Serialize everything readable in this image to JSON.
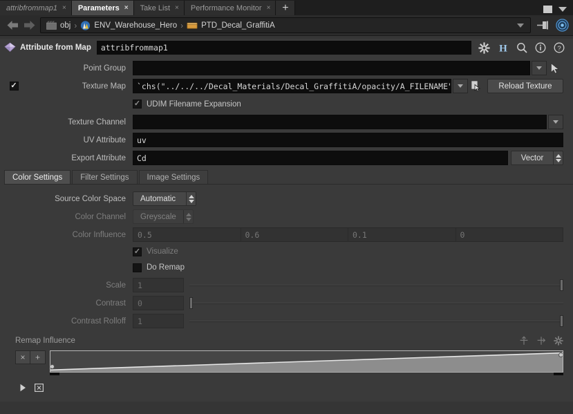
{
  "window": {
    "tabs": [
      {
        "label": "attribfrommap1",
        "active": false,
        "italic": true,
        "close": "×"
      },
      {
        "label": "Parameters",
        "active": true,
        "italic": false,
        "close": "×"
      },
      {
        "label": "Take List",
        "active": false,
        "italic": false,
        "close": "×"
      },
      {
        "label": "Performance Monitor",
        "active": false,
        "italic": false,
        "close": "×"
      }
    ],
    "add_tab_label": "+"
  },
  "breadcrumb": {
    "items": [
      {
        "label": "obj",
        "icon": "obj-network-icon"
      },
      {
        "label": "ENV_Warehouse_Hero",
        "icon": "geometry-object-icon"
      },
      {
        "label": "PTD_Decal_GraffitiA",
        "icon": "subnet-icon"
      }
    ],
    "separator": "›"
  },
  "node_header": {
    "type_label": "Attribute from Map",
    "node_name": "attribfrommap1",
    "icons": [
      "gear-icon",
      "houdini-h-icon",
      "search-icon",
      "info-icon",
      "help-icon"
    ]
  },
  "parameters": {
    "point_group": {
      "label": "Point Group",
      "value": "",
      "placeholder": ""
    },
    "texture_map": {
      "label": "Texture Map",
      "enabled": true,
      "value": "`chs(\"../../../Decal_Materials/Decal_GraffitiA/opacity/A_FILENAME\")`",
      "reload_button": "Reload Texture"
    },
    "udim": {
      "label": "UDIM Filename Expansion",
      "checked": true
    },
    "texture_channel": {
      "label": "Texture Channel",
      "value": ""
    },
    "uv_attribute": {
      "label": "UV Attribute",
      "value": "uv"
    },
    "export_attribute": {
      "label": "Export Attribute",
      "value": "Cd",
      "type_menu": "Vector"
    }
  },
  "settings_tabs": [
    {
      "label": "Color Settings",
      "active": true
    },
    {
      "label": "Filter Settings",
      "active": false
    },
    {
      "label": "Image Settings",
      "active": false
    }
  ],
  "color_settings": {
    "source_color_space": {
      "label": "Source Color Space",
      "value": "Automatic",
      "disabled": false
    },
    "color_channel": {
      "label": "Color Channel",
      "value": "Greyscale",
      "disabled": true
    },
    "color_influence": {
      "label": "Color Influence",
      "values": [
        "0.5",
        "0.6",
        "0.1",
        "0"
      ],
      "disabled": true
    },
    "visualize": {
      "label": "Visualize",
      "checked": true,
      "disabled": true
    },
    "do_remap": {
      "label": "Do Remap",
      "checked": false,
      "disabled": false
    },
    "scale": {
      "label": "Scale",
      "value": "1",
      "disabled": true,
      "slider_pct": 100
    },
    "contrast": {
      "label": "Contrast",
      "value": "0",
      "disabled": true,
      "slider_pct": 0
    },
    "contrast_rolloff": {
      "label": "Contrast Rolloff",
      "value": "1",
      "disabled": true,
      "slider_pct": 100
    }
  },
  "remap_influence": {
    "label": "Remap Influence",
    "toolbar_icons": [
      "add-point-icon",
      "delete-point-icon",
      "ramp-options-icon"
    ],
    "delete_button": "×",
    "add_button": "+",
    "play_icons": [
      "play-icon",
      "fit-range-icon"
    ],
    "ramp": {
      "type": "linear",
      "points": [
        {
          "pos": 0.0,
          "value": 0.0
        },
        {
          "pos": 1.0,
          "value": 1.0
        }
      ]
    }
  },
  "colors": {
    "panel_bg": "#3a3a3a",
    "field_bg": "#0d0d0d",
    "accent_gem": "#b9a6d6",
    "subnet_icon": "#d89a3c",
    "tab_active": "#4b4b4b"
  }
}
